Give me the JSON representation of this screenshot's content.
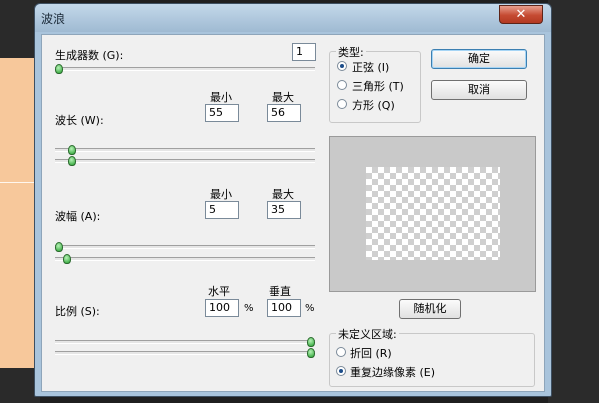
{
  "dialog": {
    "title": "波浪",
    "close_glyph": "✕"
  },
  "generators": {
    "label": "生成器数 (G):",
    "value": "1",
    "slider_fraction": 0.0
  },
  "wavelength": {
    "label": "波长 (W):",
    "min_header": "最小",
    "max_header": "最大",
    "min_value": "55",
    "max_value": "56",
    "min_slider_fraction": 0.05,
    "max_slider_fraction": 0.05
  },
  "amplitude": {
    "label": "波幅 (A):",
    "min_header": "最小",
    "max_header": "最大",
    "min_value": "5",
    "max_value": "35",
    "min_slider_fraction": 0.0,
    "max_slider_fraction": 0.03
  },
  "scale": {
    "label": "比例 (S):",
    "horizontal_header": "水平",
    "vertical_header": "垂直",
    "horizontal_value": "100",
    "vertical_value": "100",
    "unit": "%",
    "horizontal_slider_fraction": 1.0,
    "vertical_slider_fraction": 1.0
  },
  "type_group": {
    "title": "类型:",
    "options": [
      {
        "label": "正弦 (I)",
        "selected": true
      },
      {
        "label": "三角形 (T)",
        "selected": false
      },
      {
        "label": "方形 (Q)",
        "selected": false
      }
    ]
  },
  "buttons": {
    "ok": "确定",
    "cancel": "取消",
    "randomize": "随机化"
  },
  "undefined_area": {
    "title": "未定义区域:",
    "options": [
      {
        "label": "折回 (R)",
        "selected": false
      },
      {
        "label": "重复边缘像素 (E)",
        "selected": true
      }
    ]
  },
  "colors": {
    "accent_green": "#27a030",
    "title_bar": "#a9c4dc",
    "close_red": "#c54a32"
  }
}
